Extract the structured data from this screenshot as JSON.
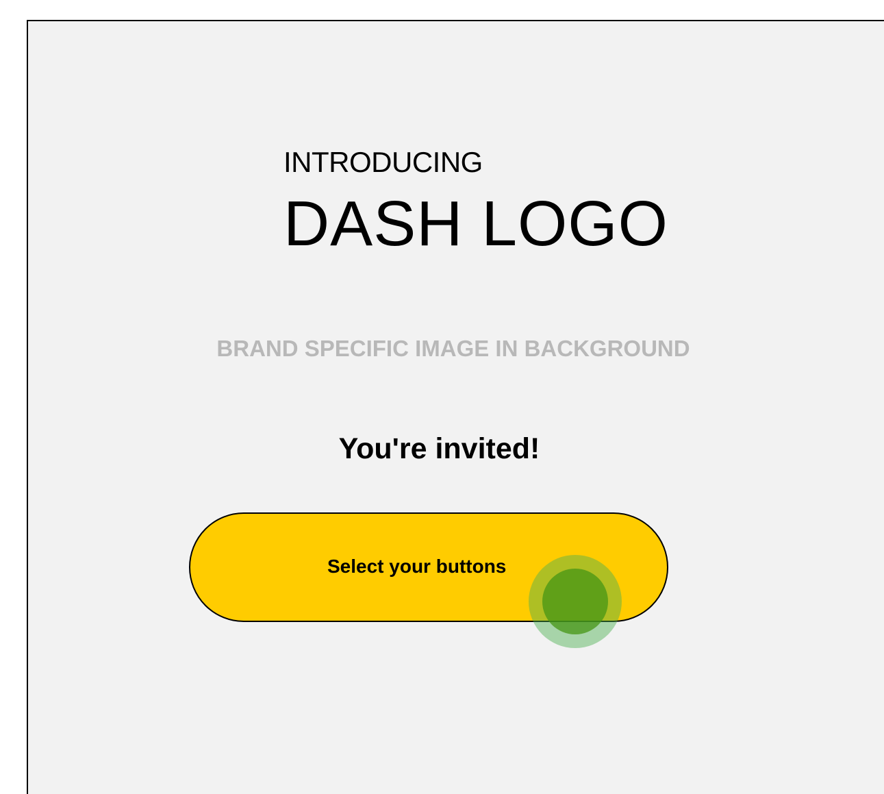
{
  "hero": {
    "kicker": "INTRODUCING",
    "title": "DASH LOGO",
    "background_note": "BRAND SPECIFIC IMAGE IN BACKGROUND"
  },
  "invite": {
    "heading": "You're invited!"
  },
  "cta": {
    "label": "Select your buttons",
    "color": "#ffcc00"
  },
  "touch_indicator": {
    "color": "#4caf50"
  }
}
